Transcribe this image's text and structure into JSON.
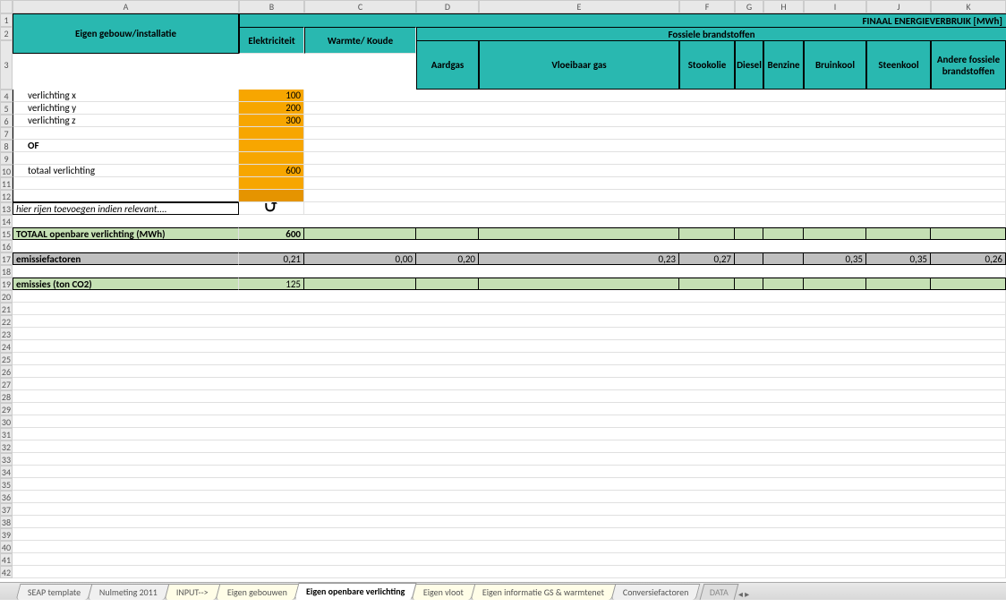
{
  "columns": [
    "A",
    "B",
    "C",
    "D",
    "E",
    "F",
    "G",
    "H",
    "I",
    "J",
    "K"
  ],
  "row_numbers": [
    1,
    2,
    3,
    4,
    5,
    6,
    7,
    8,
    9,
    10,
    11,
    12,
    13,
    14,
    15,
    16,
    17,
    18,
    19,
    20,
    21,
    22,
    23,
    24,
    25,
    26,
    27,
    28,
    29,
    30,
    31,
    32,
    33,
    34,
    35,
    36,
    37,
    38,
    39,
    40,
    41,
    42
  ],
  "header_main": "FINAAL ENERGIEVERBRUIK [MWh]",
  "label_gebouw": "Eigen gebouw/installatie",
  "label_fossiel": "Fossiele brandstoffen",
  "subheaders": {
    "elek": "Elektriciteit",
    "warmte": "Warmte/ Koude",
    "aardgas": "Aardgas",
    "vloeibaar": "Vloeibaar gas",
    "stookolie": "Stookolie",
    "diesel": "Diesel",
    "benzine": "Benzine",
    "bruinkool": "Bruinkool",
    "steenkool": "Steenkool",
    "andere": "Andere fossiele brandstoffen"
  },
  "rows": {
    "r4": {
      "label": "verlichting x",
      "val": "100"
    },
    "r5": {
      "label": "verlichting y",
      "val": "200"
    },
    "r6": {
      "label": "verlichting z",
      "val": "300"
    },
    "r8": {
      "label": "OF"
    },
    "r10": {
      "label": "totaal verlichting",
      "val": "600"
    },
    "r13": {
      "label": "hier rijen toevoegen indien relevant...."
    }
  },
  "totaal_label": "TOTAAL openbare verlichting (MWh)",
  "totaal_val": "600",
  "emissiefactoren_label": "emissiefactoren",
  "emissiefactoren": {
    "B": "0,21",
    "C": "0,00",
    "D": "0,20",
    "E": "0,23",
    "F": "0,27",
    "G": "",
    "H": "",
    "I": "0,35",
    "J": "0,35",
    "K": "0,26"
  },
  "emissies_label": "emissies (ton CO2)",
  "emissies_val": "125",
  "tabs": {
    "t1": "SEAP template",
    "t2": "Nulmeting 2011",
    "t3": "INPUT-->",
    "t4": "Eigen gebouwen",
    "t5": "Eigen openbare verlichting",
    "t6": "Eigen vloot",
    "t7": "Eigen informatie GS & warmtenet",
    "t8": "Conversiefactoren",
    "t9": "DATA"
  }
}
